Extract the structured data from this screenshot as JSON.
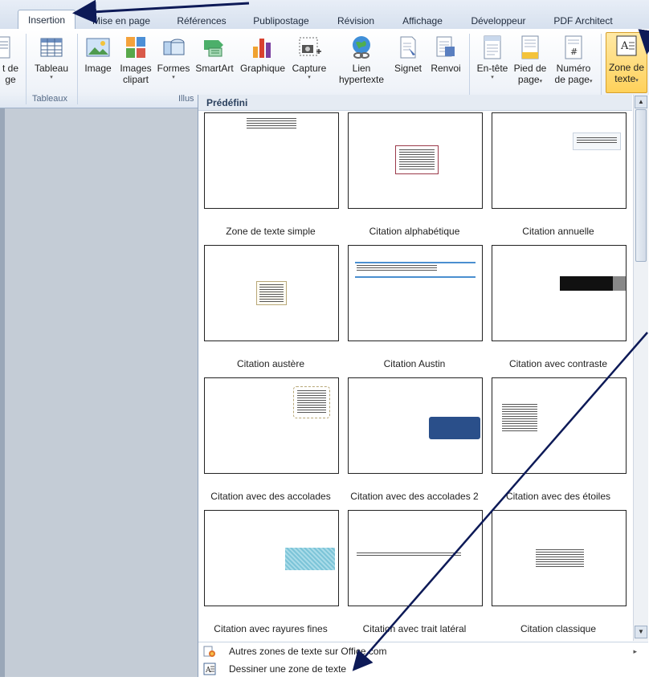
{
  "tabs": [
    {
      "label": "Insertion",
      "active": true
    },
    {
      "label": "Mise en page"
    },
    {
      "label": "Références"
    },
    {
      "label": "Publipostage"
    },
    {
      "label": "Révision"
    },
    {
      "label": "Affichage"
    },
    {
      "label": "Développeur"
    },
    {
      "label": "PDF Architect"
    }
  ],
  "ribbon": {
    "clipped_left": {
      "line1": "t de",
      "line2": "ge"
    },
    "tableau": {
      "label": "Tableau",
      "icon": "table-icon"
    },
    "image": {
      "label": "Image",
      "icon": "picture-icon"
    },
    "images_clipart": {
      "line1": "Images",
      "line2": "clipart",
      "icon": "clipart-icon"
    },
    "formes": {
      "label": "Formes",
      "icon": "shapes-icon"
    },
    "smartart": {
      "label": "SmartArt",
      "icon": "smartart-icon"
    },
    "graphique": {
      "label": "Graphique",
      "icon": "chart-icon"
    },
    "capture": {
      "label": "Capture",
      "icon": "screenshot-icon"
    },
    "lien": {
      "line1": "Lien",
      "line2": "hypertexte",
      "icon": "globe-link-icon"
    },
    "signet": {
      "label": "Signet",
      "icon": "bookmark-icon"
    },
    "renvoi": {
      "label": "Renvoi",
      "icon": "cross-reference-icon"
    },
    "entete": {
      "label": "En-tête",
      "icon": "header-icon"
    },
    "pied": {
      "line1": "Pied de",
      "line2": "page",
      "icon": "footer-icon"
    },
    "numero": {
      "line1": "Numéro",
      "line2": "de page",
      "icon": "page-number-icon"
    },
    "zone": {
      "line1": "Zone de",
      "line2": "texte",
      "icon": "text-box-icon"
    },
    "groups": {
      "tableaux": "Tableaux",
      "illus": "Illus"
    },
    "dropdown_arrow": "▾"
  },
  "gallery": {
    "header": "Prédéfini",
    "items": [
      "Zone de texte simple",
      "Citation alphabétique",
      "Citation annuelle",
      "Citation austère",
      "Citation Austin",
      "Citation avec contraste",
      "Citation avec des accolades",
      "Citation avec des accolades 2",
      "Citation avec des étoiles",
      "Citation avec rayures fines",
      "Citation avec trait latéral",
      "Citation classique"
    ]
  },
  "menu": {
    "more": "Autres zones de texte sur Office.com",
    "draw": "Dessiner une zone de texte",
    "more_arrow": "▸"
  },
  "colors": {
    "highlight": "#ffd15a",
    "accent": "#1f3a6e",
    "arrow": "#0d1a57"
  }
}
